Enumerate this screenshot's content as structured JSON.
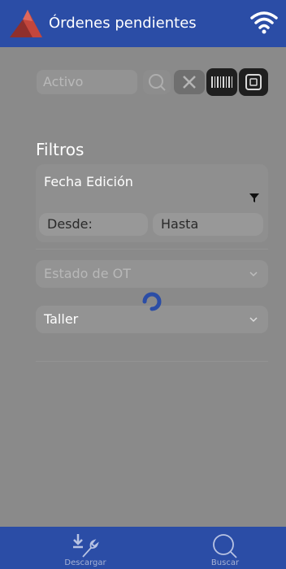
{
  "header": {
    "title": "Órdenes pendientes",
    "logo_icon": "app-logo-icon",
    "wifi_icon": "wifi-icon"
  },
  "search": {
    "value": "Activo",
    "search_icon": "search-icon",
    "clear_icon": "close-icon",
    "barcode_icon": "barcode-icon",
    "rfid_icon": "rfid-icon"
  },
  "filters": {
    "title": "Filtros",
    "date": {
      "label": "Fecha Edición",
      "from_label": "Desde:",
      "to_label": "Hasta",
      "filter_icon": "funnel-icon"
    },
    "estado": {
      "label": "Estado de OT",
      "chevron_icon": "chevron-down-icon"
    },
    "taller": {
      "label": "Taller",
      "chevron_icon": "chevron-down-icon"
    }
  },
  "loading_icon": "loading-spinner-icon",
  "bottom_nav": {
    "items": [
      {
        "label": "Descargar",
        "icon": "download-wrench-icon"
      },
      {
        "label": "Buscar",
        "icon": "search-icon"
      }
    ]
  },
  "colors": {
    "primary": "#2b4da6",
    "overlay_gray": "#8a8a8a",
    "spinner": "#2b4da6",
    "dark_button": "#1f1f1f"
  }
}
